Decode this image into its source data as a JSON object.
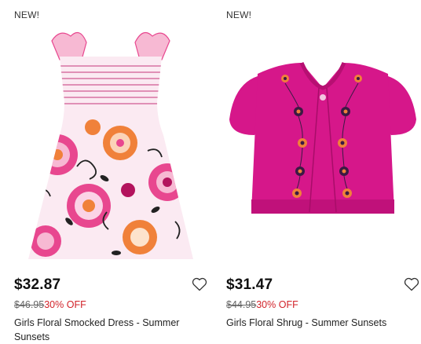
{
  "products": [
    {
      "badge": "NEW!",
      "price": "$32.87",
      "original_price": "$46.95",
      "discount": "30% OFF",
      "name": "Girls Floral Smocked Dress - Summer Sunsets",
      "image_icon": "floral-dress-image"
    },
    {
      "badge": "NEW!",
      "price": "$31.47",
      "original_price": "$44.95",
      "discount": "30% OFF",
      "name": "Girls Floral Shrug - Summer Sunsets",
      "image_icon": "pink-cardigan-image"
    }
  ],
  "colors": {
    "sale_red": "#d2232a",
    "dress_pink": "#e8478f",
    "shrug_magenta": "#d6178a",
    "floral_orange": "#f0813a"
  }
}
